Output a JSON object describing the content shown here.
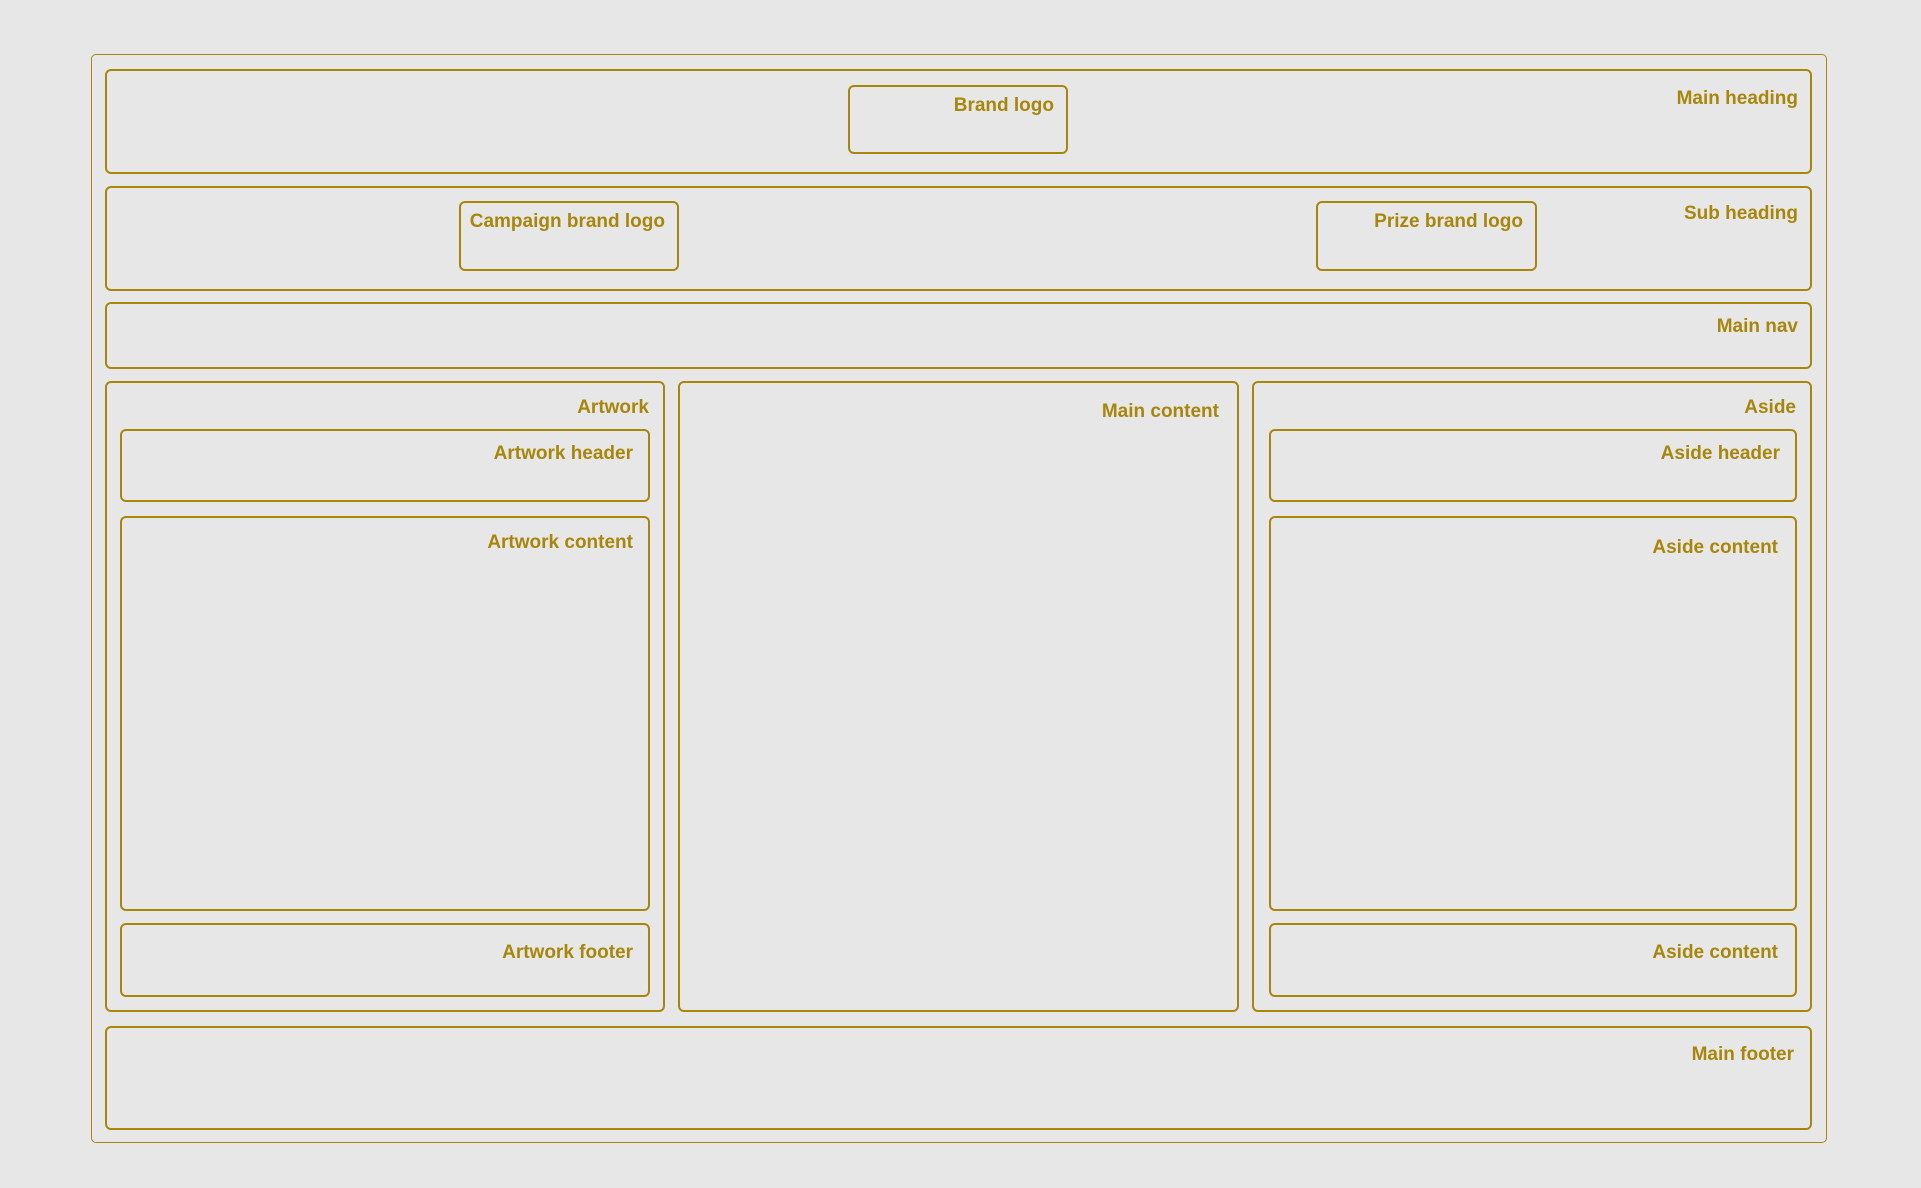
{
  "diagram": {
    "accent_color": "#a8860b",
    "background_color": "#e7e7e7",
    "main_heading": {
      "label": "Main heading",
      "brand_logo_label": "Brand logo"
    },
    "sub_heading": {
      "label": "Sub heading",
      "campaign_logo_label": "Campaign brand logo",
      "prize_logo_label": "Prize brand logo"
    },
    "main_nav": {
      "label": "Main nav"
    },
    "artwork": {
      "label": "Artwork",
      "header_label": "Artwork header",
      "content_label": "Artwork content",
      "footer_label": "Artwork footer"
    },
    "main_content": {
      "label": "Main content"
    },
    "aside": {
      "label": "Aside",
      "header_label": "Aside header",
      "content_label": "Aside content",
      "footer_label": "Aside content"
    },
    "main_footer": {
      "label": "Main footer"
    }
  }
}
